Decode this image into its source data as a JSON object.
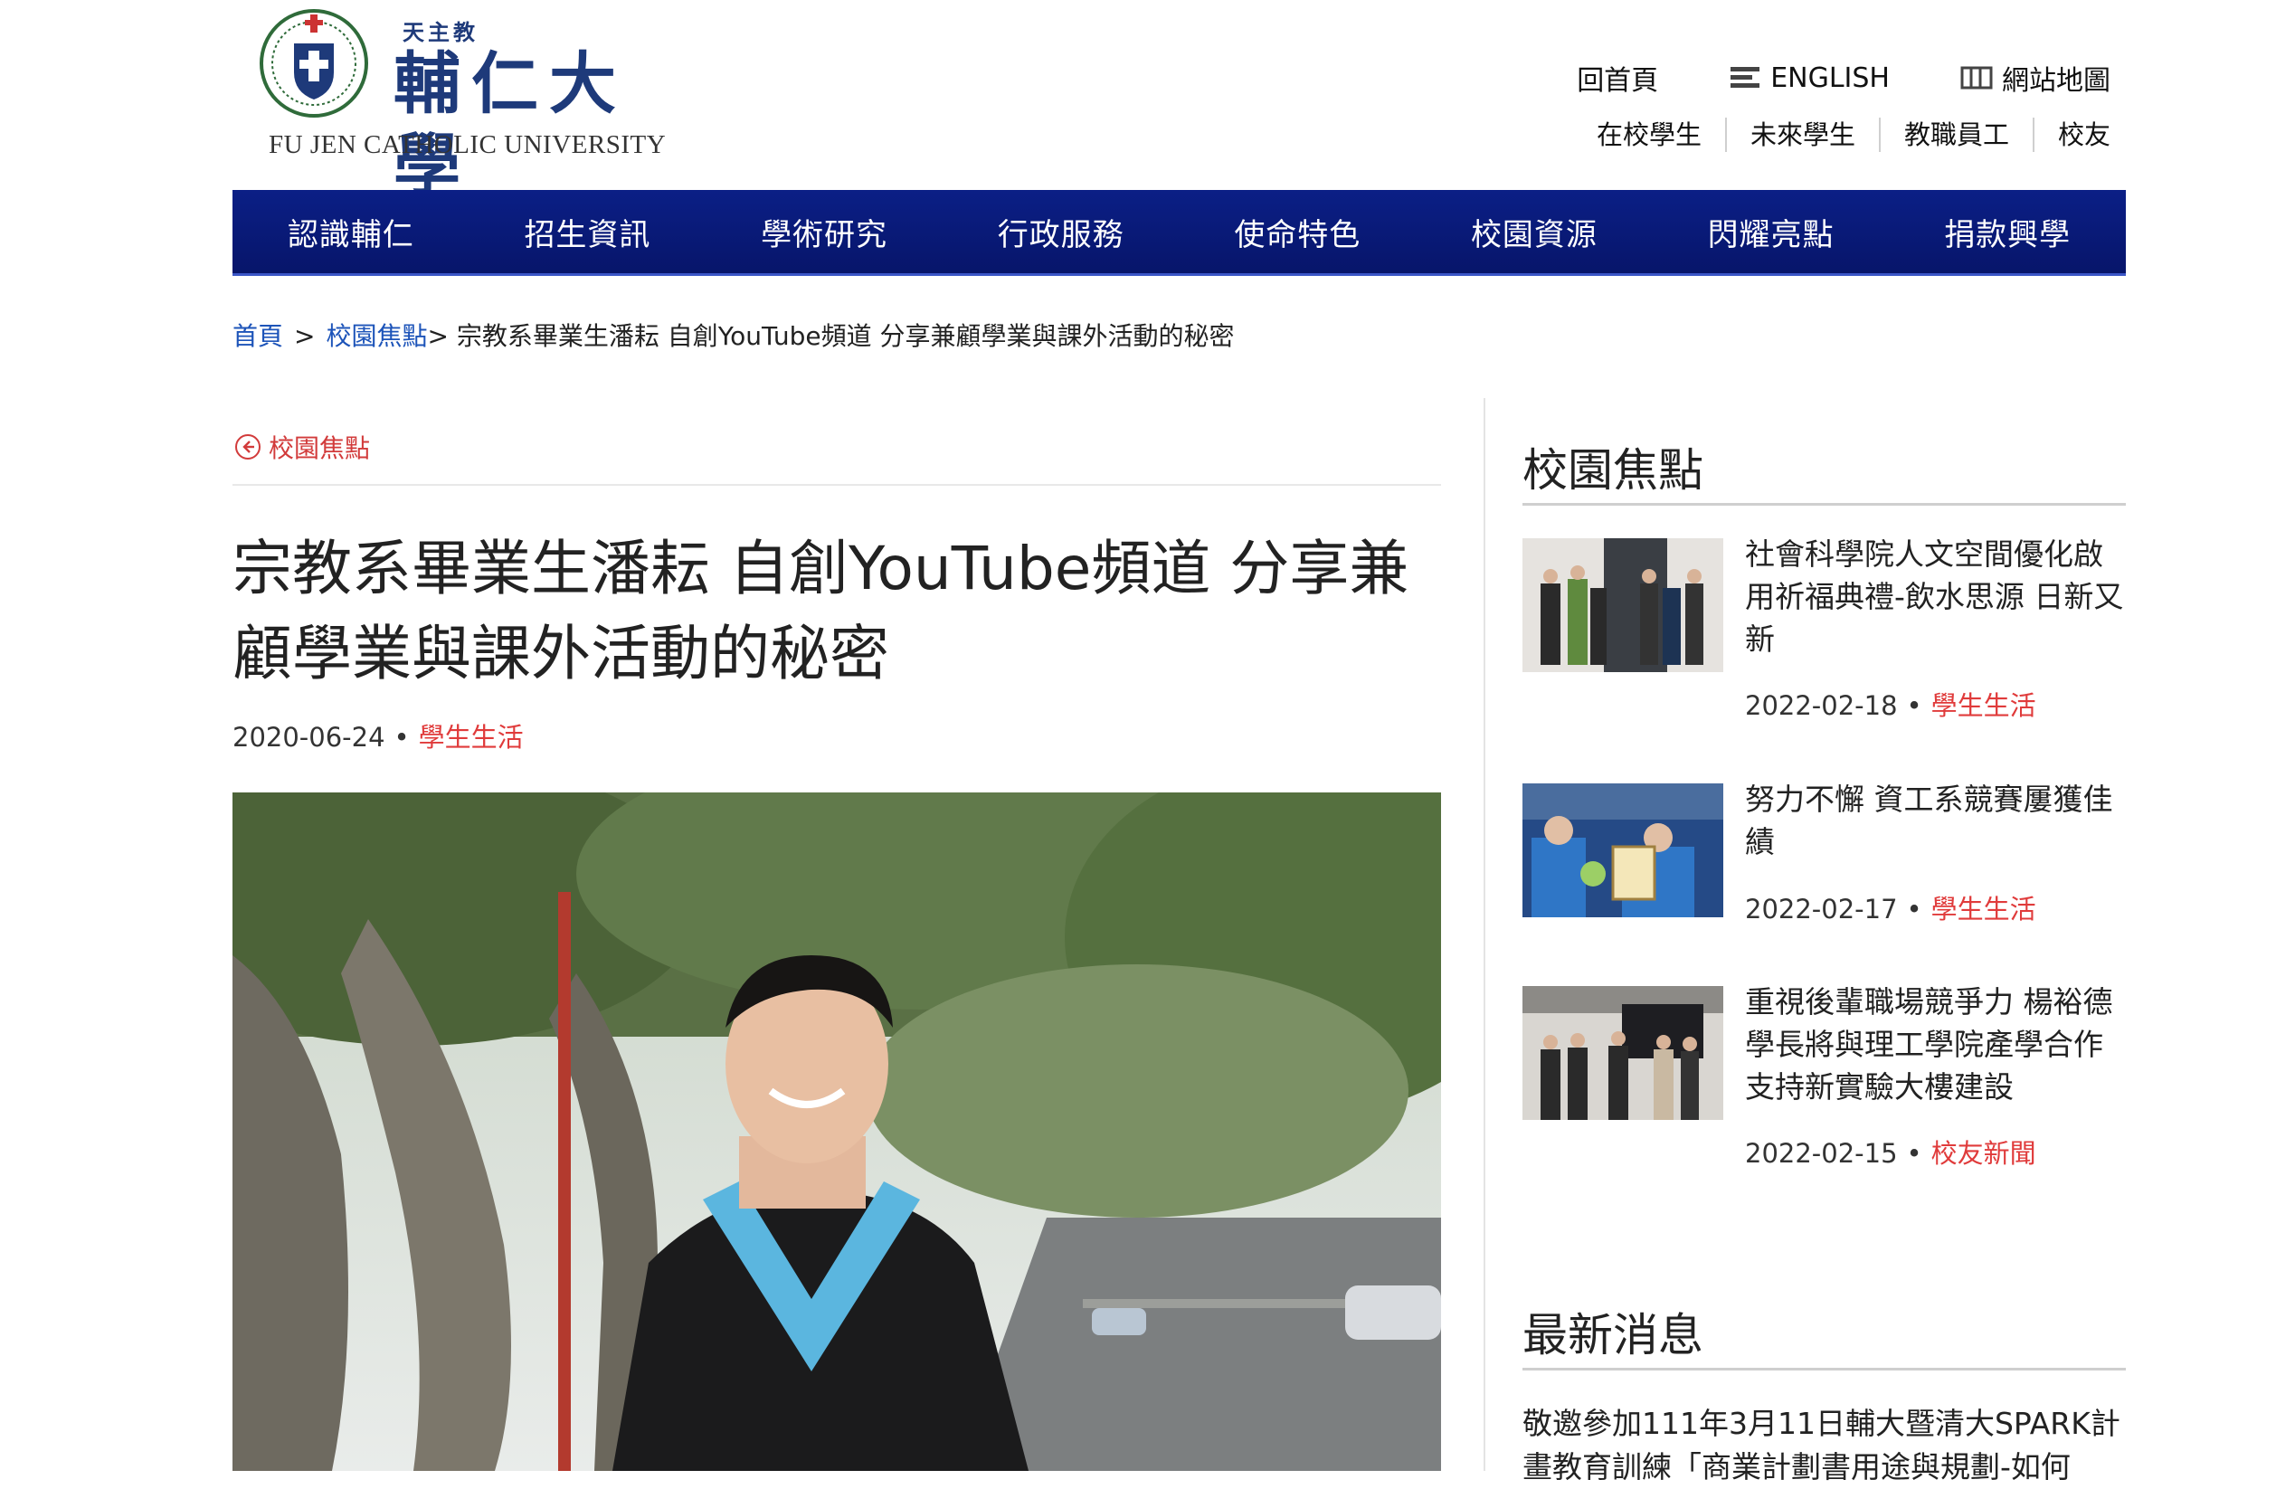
{
  "brand": {
    "tagline": "天主教",
    "name_zh": "輔仁大學",
    "name_en": "FU JEN CATHOLIC UNIVERSITY"
  },
  "utility_nav": [
    {
      "label": "回首頁",
      "icon": "home-link"
    },
    {
      "label": "ENGLISH",
      "icon": "language-icon"
    },
    {
      "label": "網站地圖",
      "icon": "sitemap-icon"
    }
  ],
  "audience_nav": [
    "在校學生",
    "未來學生",
    "教職員工",
    "校友"
  ],
  "main_nav": [
    "認識輔仁",
    "招生資訊",
    "學術研究",
    "行政服務",
    "使命特色",
    "校園資源",
    "閃耀亮點",
    "捐款興學"
  ],
  "breadcrumb": {
    "home": "首頁",
    "section": "校園焦點",
    "current": "宗教系畢業生潘耘 自創YouTube頻道 分享兼顧學業與課外活動的秘密",
    "sep": ">"
  },
  "article": {
    "back_label": "校園焦點",
    "title": "宗教系畢業生潘耘 自創YouTube頻道 分享兼顧學業與課外活動的秘密",
    "date": "2020-06-24",
    "dot": "•",
    "category": "學生生活"
  },
  "sidebar": {
    "focus_heading": "校園焦點",
    "focus_items": [
      {
        "title": "社會科學院人文空間優化啟用祈福典禮-飲水思源 日新又新",
        "date": "2022-02-18",
        "category": "學生生活"
      },
      {
        "title": "努力不懈 資工系競賽屢獲佳績",
        "date": "2022-02-17",
        "category": "學生生活"
      },
      {
        "title": "重視後輩職場競爭力 楊裕德學長將與理工學院產學合作 支持新實驗大樓建設",
        "date": "2022-02-15",
        "category": "校友新聞"
      }
    ],
    "latest_heading": "最新消息",
    "latest_first": "敬邀參加111年3月11日輔大暨清大SPARK計畫教育訓練「商業計劃書用途與規劃-如何"
  },
  "colors": {
    "nav_bg": "#0b1f86",
    "link_blue": "#1d54b9",
    "category_red": "#e03b3b",
    "brand_blue": "#1e3a7a"
  }
}
